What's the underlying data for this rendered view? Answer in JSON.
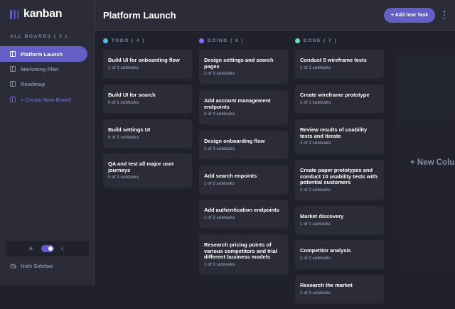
{
  "logo": {
    "text": "kanban"
  },
  "sidebar": {
    "all_boards_label": "ALL BOARDS ( 3 )",
    "boards": [
      {
        "label": "Platform Launch",
        "active": true
      },
      {
        "label": "Marketing Plan",
        "active": false
      },
      {
        "label": "Roadmap",
        "active": false
      }
    ],
    "create_label": "+ Create New Board",
    "hide_label": "Hide Sidebar",
    "theme_dark": true
  },
  "header": {
    "title": "Platform Launch",
    "add_task_label": "+ Add new Task"
  },
  "columns": [
    {
      "title": "TODO ( 4 )",
      "color": "#49c4e5",
      "cards": [
        {
          "title": "Build UI for onboarding flow",
          "subtasks": "1 of 3 subtasks"
        },
        {
          "title": "Build UI for search",
          "subtasks": "0 of 1 subtasks"
        },
        {
          "title": "Build settings UI",
          "subtasks": "0 of 2 subtasks"
        },
        {
          "title": "QA and test all major user journeys",
          "subtasks": "0 of 2 subtasks"
        }
      ]
    },
    {
      "title": "DOING ( 6 )",
      "color": "#8471f2",
      "cards": [
        {
          "title": "Design settings and search pages",
          "subtasks": "2 of 3 subtasks"
        },
        {
          "title": "Add account management endpoints",
          "subtasks": "2 of 3 subtasks"
        },
        {
          "title": "Design onboarding flow",
          "subtasks": "1 of 3 subtasks"
        },
        {
          "title": "Add search enpoints",
          "subtasks": "1 of 2 subtasks"
        },
        {
          "title": "Add authentication endpoints",
          "subtasks": "1 of 2 subtasks"
        },
        {
          "title": "Research pricing points of various competitors and trial different business models",
          "subtasks": "1 of 3 subtasks"
        }
      ]
    },
    {
      "title": "DONE ( 7 )",
      "color": "#67e2ae",
      "cards": [
        {
          "title": "Conduct 5 wireframe tests",
          "subtasks": "1 of 1 subtasks"
        },
        {
          "title": "Create wireframe prototype",
          "subtasks": "1 of 1 subtasks"
        },
        {
          "title": "Review results of usability tests and iterate",
          "subtasks": "3 of 3 subtasks"
        },
        {
          "title": "Create paper prototypes and conduct 10 usability tests with potential customers",
          "subtasks": "2 of 2 subtasks"
        },
        {
          "title": "Market discovery",
          "subtasks": "1 of 1 subtasks"
        },
        {
          "title": "Competitor analysis",
          "subtasks": "2 of 2 subtasks"
        },
        {
          "title": "Research the market",
          "subtasks": "2 of 2 subtasks"
        }
      ]
    }
  ],
  "new_column_label": "+ New Column",
  "colors": {
    "accent": "#635fc7",
    "background": "#20212c",
    "panel": "#2b2c37",
    "muted_text": "#828fa3"
  }
}
